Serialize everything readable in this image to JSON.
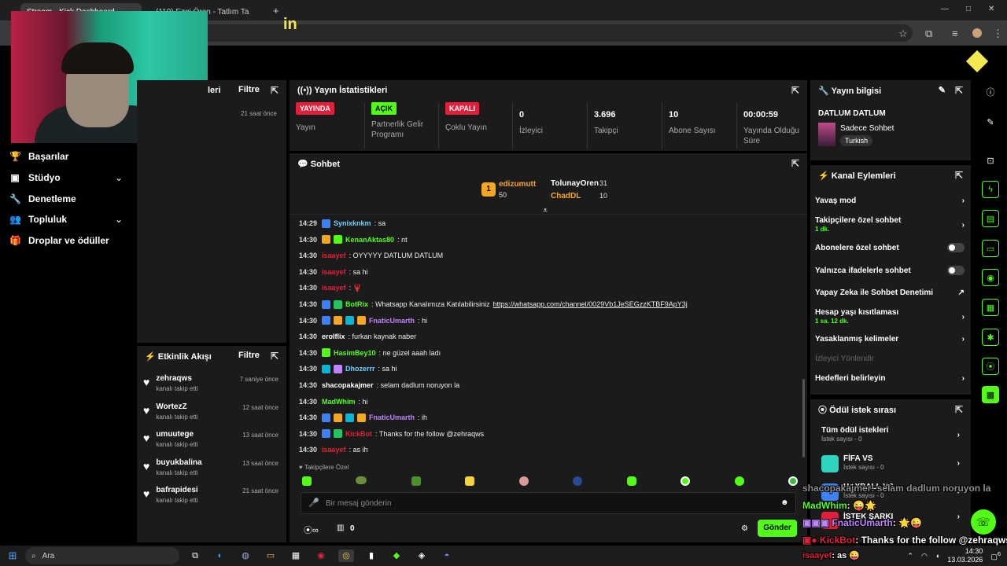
{
  "browser": {
    "tabs": [
      {
        "label": "Stream - Kick Dashboard"
      },
      {
        "label": "(110) Ezgi Ören - Tatlım Ta"
      }
    ],
    "new_tab": "+",
    "min": "—",
    "max": "□",
    "close": "✕",
    "overlay_text": "in"
  },
  "nav": {
    "items": [
      {
        "label": "Başarılar"
      },
      {
        "label": "Stüdyo"
      },
      {
        "label": "Denetleme"
      },
      {
        "label": "Topluluk"
      },
      {
        "label": "Droplar ve ödüller"
      }
    ]
  },
  "left_panel": {
    "title_suffix": "leri",
    "filter": "Filtre",
    "time": "21 saat önce"
  },
  "stats": {
    "title": "Yayın İstatistikleri",
    "items": [
      {
        "badge": "YAYINDA",
        "badge_color": "#e0203a",
        "label": "Yayın"
      },
      {
        "badge": "AÇIK",
        "badge_color": "#53fc18",
        "label": "Partnerlik Gelir Programı"
      },
      {
        "badge": "KAPALI",
        "badge_color": "#e0203a",
        "label": "Çoklu Yayın"
      },
      {
        "value": "0",
        "label": "İzleyici"
      },
      {
        "value": "3.696",
        "label": "Takipçi"
      },
      {
        "value": "10",
        "label": "Abone Sayısı"
      },
      {
        "value": "00:00:59",
        "label": "Yayında Olduğu Süre"
      }
    ]
  },
  "chat": {
    "title": "Sohbet",
    "leaders": [
      {
        "rank": "1",
        "name": "edizumutt",
        "count": "50",
        "color": "#f5a623"
      },
      {
        "name": "TolunayOren",
        "count": "31",
        "color": "#ffffff"
      },
      {
        "name": "ChadDL",
        "count": "10",
        "color": "#f5a623"
      }
    ],
    "messages": [
      {
        "time": "14:29",
        "user": "Synixknkm",
        "color": "#6fd0ff",
        "text": ": sa",
        "badges": [
          "#3b82f6"
        ]
      },
      {
        "time": "14:30",
        "user": "KenanAktas80",
        "color": "#53fc18",
        "text": ": nt",
        "badges": [
          "#f5a623",
          "#53fc18"
        ]
      },
      {
        "time": "14:30",
        "user": "isaayef",
        "color": "#e0203a",
        "text": ": OYYYYY DATLUM DATLUM",
        "badges": []
      },
      {
        "time": "14:30",
        "user": "isaayef",
        "color": "#e0203a",
        "text": ": sa hi",
        "badges": []
      },
      {
        "time": "14:30",
        "user": "isaayef",
        "color": "#e0203a",
        "text": ": 🦞",
        "badges": []
      },
      {
        "time": "14:30",
        "user": "BotRix",
        "color": "#53fc18",
        "text": ": Whatsapp Kanalımıza Katılabilirsiniz ",
        "link": "https://whatsapp.com/channel/0029Vb1JeSEGzzKTBF9ApY3j",
        "badges": [
          "#3b82f6",
          "#22c55e"
        ]
      },
      {
        "time": "14:30",
        "user": "FnaticUmarth",
        "color": "#c084fc",
        "text": ": hi",
        "badges": [
          "#3b82f6",
          "#f5a623",
          "#06b6d4",
          "#f5a623"
        ]
      },
      {
        "time": "14:30",
        "user": "erolflix",
        "color": "#ffffff",
        "text": ": furkan kaynak naber",
        "badges": []
      },
      {
        "time": "14:30",
        "user": "HasimBey10",
        "color": "#53fc18",
        "text": ": ne güzel aaah ladı",
        "badges": [
          "#53fc18"
        ]
      },
      {
        "time": "14:30",
        "user": "Dhozerrr",
        "color": "#6fd0ff",
        "text": ": sa hi",
        "badges": [
          "#06b6d4",
          "#c084fc"
        ]
      },
      {
        "time": "14:30",
        "user": "shacopakajmer",
        "color": "#ffffff",
        "text": ": selam dadlum noruyon la",
        "badges": []
      },
      {
        "time": "14:30",
        "user": "MadWhim",
        "color": "#53fc18",
        "text": ": hi",
        "badges": []
      },
      {
        "time": "14:30",
        "user": "FnaticUmarth",
        "color": "#c084fc",
        "text": ": ih",
        "badges": [
          "#3b82f6",
          "#f5a623",
          "#06b6d4",
          "#f5a623"
        ]
      },
      {
        "time": "14:30",
        "user": "KickBot",
        "color": "#e0203a",
        "text": ": Thanks for the follow @zehraqws",
        "badges": [
          "#3b82f6",
          "#22c55e"
        ]
      },
      {
        "time": "14:30",
        "user": "isaayef",
        "color": "#e0203a",
        "text": ": as ih",
        "badges": []
      }
    ],
    "mode_label": "Takipçilere Özel",
    "placeholder": "Bir mesaj gönderin",
    "points": "0",
    "send": "Gönder"
  },
  "activity": {
    "title": "Etkinlik Akışı",
    "filter": "Filtre",
    "items": [
      {
        "name": "zehraqws",
        "desc": "kanalı takip etti",
        "time": "7 saniye önce"
      },
      {
        "name": "WortezZ",
        "desc": "kanalı takip etti",
        "time": "12 saat önce"
      },
      {
        "name": "umuutege",
        "desc": "kanalı takip etti",
        "time": "13 saat önce"
      },
      {
        "name": "buyukbalina",
        "desc": "kanalı takip etti",
        "time": "13 saat önce"
      },
      {
        "name": "bafrapidesi",
        "desc": "kanalı takip etti",
        "time": "21 saat önce"
      }
    ]
  },
  "stream_info": {
    "title": "Yayın bilgisi",
    "stream_title": "DATLUM DATLUM",
    "category": "Sadece Sohbet",
    "tag": "Turkish"
  },
  "channel_actions": {
    "title": "Kanal Eylemleri",
    "items": [
      {
        "label": "Yavaş mod"
      },
      {
        "label": "Takipçilere özel sohbet",
        "sub": "1 dk."
      },
      {
        "label": "Abonelere özel sohbet"
      },
      {
        "label": "Yalnızca ifadelerle sohbet"
      },
      {
        "label": "Yapay Zeka ile Sohbet Denetimi"
      },
      {
        "label": "Hesap yaşı kısıtlaması",
        "sub": "1 sa. 12 dk."
      },
      {
        "label": "Yasaklanmış kelimeler"
      },
      {
        "label": "İzleyici Yönlendir"
      },
      {
        "label": "Hedefleri belirleyin"
      }
    ]
  },
  "rewards": {
    "title": "Ödül istek sırası",
    "items": [
      {
        "label": "Tüm ödül istekleri",
        "sub": "İstek sayısı - 0"
      },
      {
        "label": "FİFA VS",
        "sub": "İstek sayısı - 0"
      },
      {
        "label": "HAXBALL VS",
        "sub": "İstek sayısı - 0"
      },
      {
        "label": "İSTEK ŞARKI",
        "sub": ""
      }
    ]
  },
  "overlay": [
    {
      "user": "shacopakajmer",
      "text": ": selam dadlum noruyon la",
      "color": "#ffffff"
    },
    {
      "user": "MadWhim",
      "text": ": 😜🌟",
      "color": "#53fc18"
    },
    {
      "user": "FnaticUmarth",
      "text": ": 🌟😜",
      "color": "#c084fc"
    },
    {
      "user": "KickBot",
      "text": ": Thanks for the follow @zehraqws",
      "color": "#e0203a"
    },
    {
      "user": "isaayef",
      "text": ": as 😜",
      "color": "#e0203a"
    }
  ],
  "taskbar": {
    "search": "Ara",
    "time": "14:30",
    "date": "13.03.2026",
    "notif": "6"
  }
}
